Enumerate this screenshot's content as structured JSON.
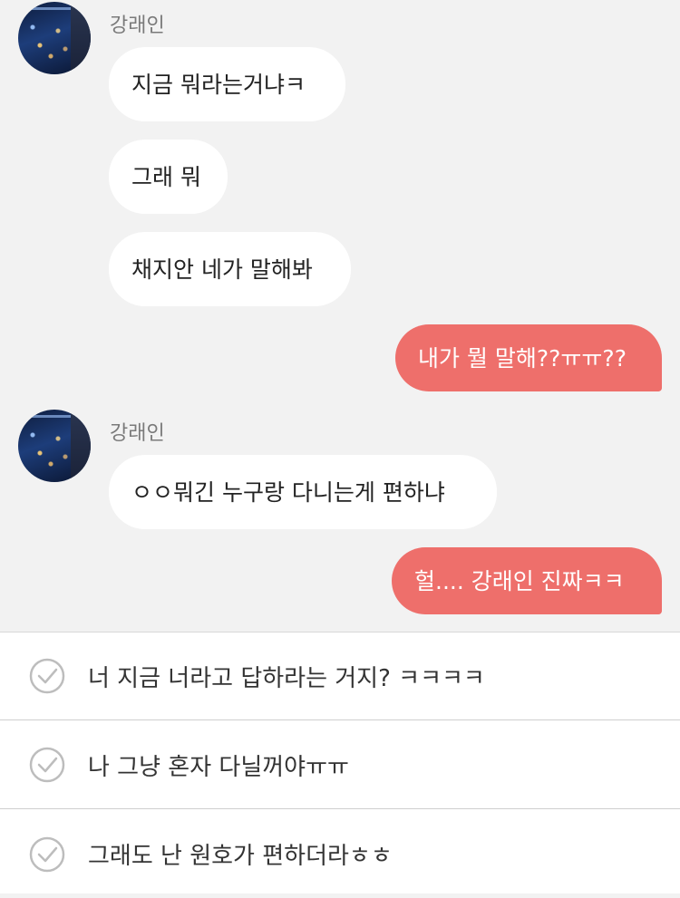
{
  "chat": {
    "messages": [
      {
        "sender": "강래인",
        "from": "other",
        "texts": [
          "지금 뭐라는거냐ㅋ",
          "그래 뭐",
          "채지안 네가 말해봐"
        ]
      },
      {
        "from": "me",
        "text": "내가 뭘 말해??ㅠㅠ??"
      },
      {
        "sender": "강래인",
        "from": "other",
        "texts": [
          "ㅇㅇ뭐긴 누구랑 다니는게 편하냐"
        ]
      },
      {
        "from": "me",
        "text": "헐.... 강래인 진짜ㅋㅋ"
      }
    ]
  },
  "reply_options": [
    {
      "label": "너 지금 너라고 답하라는 거지? ㅋㅋㅋㅋ",
      "icon": "check-circle-icon"
    },
    {
      "label": "나 그냥 혼자 다닐꺼야ㅠㅠ",
      "icon": "check-circle-icon"
    },
    {
      "label": "그래도 난 원호가 편하더라ㅎㅎ",
      "icon": "check-circle-icon"
    }
  ],
  "colors": {
    "background": "#f2f2f2",
    "incoming_bubble": "#ffffff",
    "outgoing_bubble": "#ee6f6b",
    "sender_name": "#7a7a7a"
  }
}
